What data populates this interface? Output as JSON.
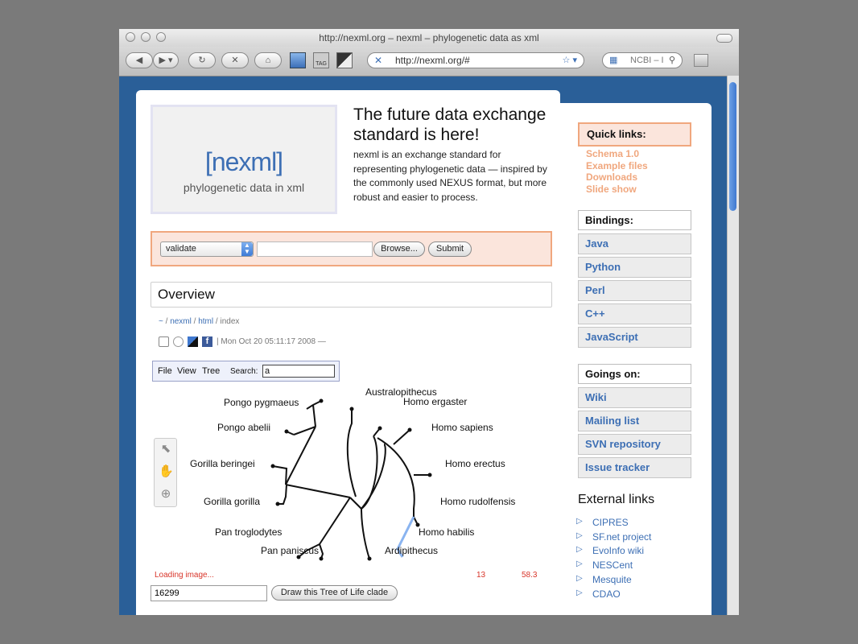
{
  "window": {
    "title": "http://nexml.org – nexml – phylogenetic data as xml",
    "url": "http://nexml.org/#",
    "search_placeholder": "NCBI – I"
  },
  "logo": {
    "word": "[nexml]",
    "tagline": "phylogenetic data in xml"
  },
  "hero": {
    "headline": "The future data exchange standard is here!",
    "intro": "nexml is an exchange standard for representing phylogenetic data — inspired by the commonly used NEXUS format, but more robust and easier to process."
  },
  "form": {
    "select_value": "validate",
    "browse_label": "Browse...",
    "submit_label": "Submit"
  },
  "overview": {
    "title": "Overview",
    "breadcrumb": {
      "home": "~",
      "sep": "/",
      "nexml": "nexml",
      "html": "html",
      "index": "index"
    },
    "timestamp": "| Mon Oct 20 05:11:17 2008 —"
  },
  "treeviewer": {
    "menu": {
      "file": "File",
      "view": "View",
      "tree": "Tree",
      "search_label": "Search:",
      "search_value": "a"
    },
    "taxa": {
      "australopithecus": "Australopithecus",
      "homo_ergaster": "Homo ergaster",
      "homo_sapiens": "Homo sapiens",
      "homo_erectus": "Homo erectus",
      "homo_rudolfensis": "Homo rudolfensis",
      "homo_habilis": "Homo habilis",
      "ardipithecus": "Ardipithecus",
      "pan_paniscus": "Pan paniscus",
      "pan_troglodytes": "Pan troglodytes",
      "gorilla_gorilla": "Gorilla gorilla",
      "gorilla_beringei": "Gorilla beringei",
      "pongo_abelii": "Pongo abelii",
      "pongo_pygmaeus": "Pongo pygmaeus"
    },
    "status": "Loading image...",
    "stat_a": "13",
    "stat_b": "58.3",
    "clade_value": "16299",
    "clade_button": "Draw this Tree of Life clade",
    "highlight_color": "#8ab4f0"
  },
  "sidebar": {
    "quick_links": {
      "title": "Quick links:",
      "items": [
        "Schema 1.0",
        "Example files",
        "Downloads",
        "Slide show"
      ]
    },
    "bindings": {
      "title": "Bindings:",
      "items": [
        "Java",
        "Python",
        "Perl",
        "C++",
        "JavaScript"
      ]
    },
    "goings_on": {
      "title": "Goings on:",
      "items": [
        "Wiki",
        "Mailing list",
        "SVN repository",
        "Issue tracker"
      ]
    },
    "external_links": {
      "title": "External links",
      "items": [
        "CIPRES",
        "SF.net project",
        "EvoInfo wiki",
        "NESCent",
        "Mesquite",
        "CDAO"
      ]
    }
  },
  "colors": {
    "accent": "#f0a77e",
    "link": "#3d6fb4",
    "window_bg": "#2a5f98",
    "error": "#d8352a"
  }
}
